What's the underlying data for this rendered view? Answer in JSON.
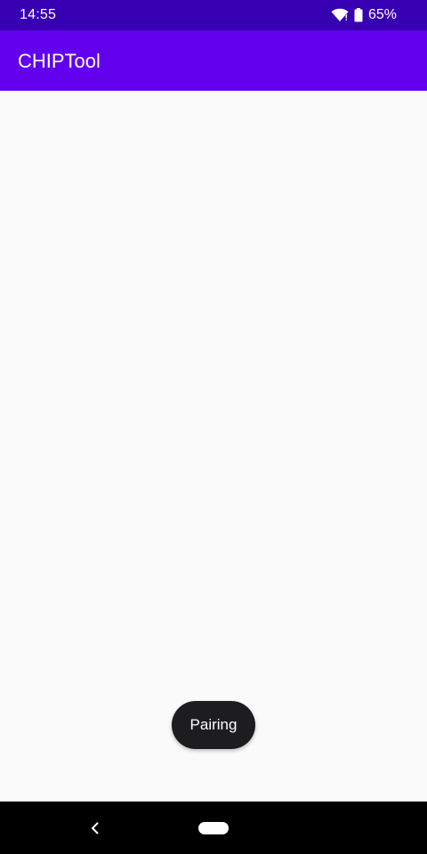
{
  "status_bar": {
    "time": "14:55",
    "battery_percent": "65%",
    "wifi_icon": "wifi-alert-icon",
    "battery_icon": "battery-icon",
    "background": "#3700b3"
  },
  "app_bar": {
    "title": "CHIPTool",
    "background": "#6200ee"
  },
  "toast": {
    "message": "Pairing"
  },
  "nav_bar": {
    "back_icon": "back-icon",
    "home_icon": "home-pill-icon"
  }
}
